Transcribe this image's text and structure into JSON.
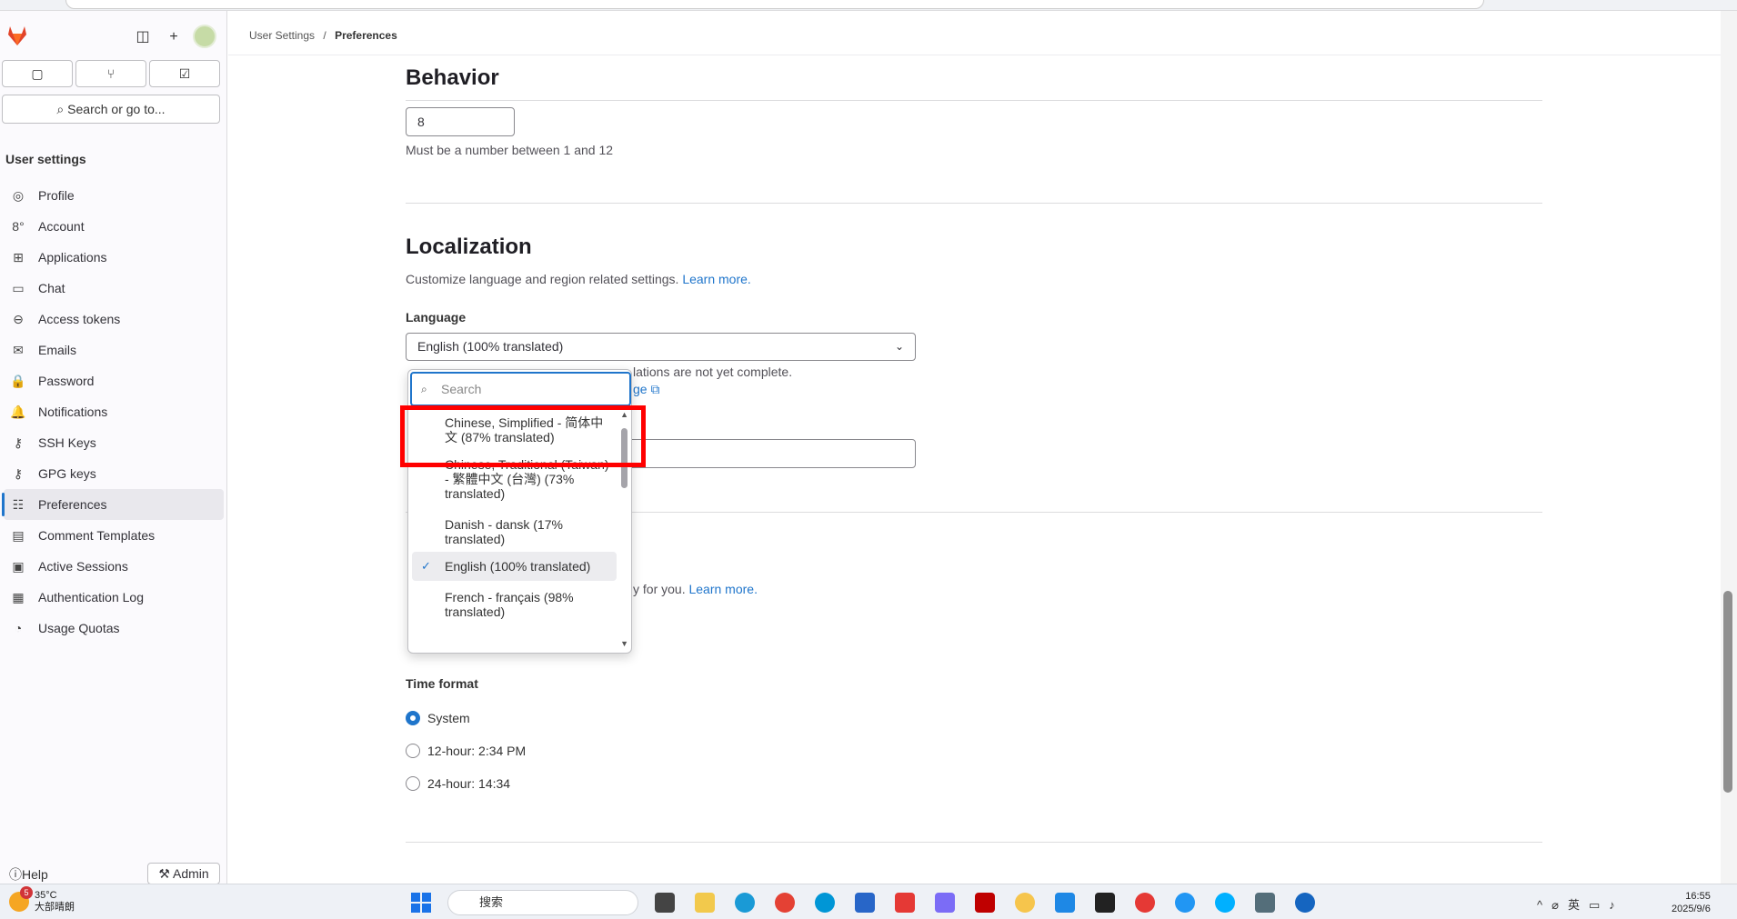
{
  "sidebar": {
    "search_label": "Search or go to...",
    "heading": "User settings",
    "items": [
      {
        "label": "Profile",
        "icon": "◎"
      },
      {
        "label": "Account",
        "icon": "8°"
      },
      {
        "label": "Applications",
        "icon": "⊞"
      },
      {
        "label": "Chat",
        "icon": "▭"
      },
      {
        "label": "Access tokens",
        "icon": "⊖"
      },
      {
        "label": "Emails",
        "icon": "✉"
      },
      {
        "label": "Password",
        "icon": "🔒"
      },
      {
        "label": "Notifications",
        "icon": "🔔"
      },
      {
        "label": "SSH Keys",
        "icon": "⚷"
      },
      {
        "label": "GPG keys",
        "icon": "⚷"
      },
      {
        "label": "Preferences",
        "icon": "☷"
      },
      {
        "label": "Comment Templates",
        "icon": "▤"
      },
      {
        "label": "Active Sessions",
        "icon": "▣"
      },
      {
        "label": "Authentication Log",
        "icon": "▦"
      },
      {
        "label": "Usage Quotas",
        "icon": "◔"
      }
    ],
    "help_label": "Help",
    "admin_label": "Admin"
  },
  "breadcrumb": {
    "parent": "User Settings",
    "sep": "/",
    "current": "Preferences"
  },
  "behavior": {
    "title": "Behavior",
    "value": "8",
    "help": "Must be a number between 1 and 12"
  },
  "localization": {
    "title": "Localization",
    "desc": "Customize language and region related settings.",
    "learn_more": "Learn more.",
    "language_label": "Language",
    "language_value": "English (100% translated)",
    "note_partial": "lations are not yet complete.",
    "note_link": "ge",
    "second_note": "y for you.",
    "second_learn": "Learn more."
  },
  "dropdown": {
    "search_placeholder": "Search",
    "options": [
      {
        "label": "Chinese, Simplified - 简体中文 (87% translated)",
        "selected": false
      },
      {
        "label": "Chinese, Traditional (Taiwan) - 繁體中文 (台灣) (73% translated)",
        "selected": false
      },
      {
        "label": "Danish - dansk (17% translated)",
        "selected": false
      },
      {
        "label": "English (100% translated)",
        "selected": true
      },
      {
        "label": "French - français (98% translated)",
        "selected": false
      }
    ]
  },
  "time_format": {
    "label": "Time format",
    "options": [
      {
        "label": "System",
        "checked": true
      },
      {
        "label": "12-hour: 2:34 PM",
        "checked": false
      },
      {
        "label": "24-hour: 14:34",
        "checked": false
      }
    ]
  },
  "taskbar": {
    "weather_temp": "35°C",
    "weather_desc": "大部晴朗",
    "weather_badge": "5",
    "search_label": "搜索",
    "tray_lang": "英",
    "time": "16:55",
    "date": "2025/9/6"
  },
  "colors": {
    "accent": "#1f75cb",
    "highlight": "#ff0000"
  }
}
